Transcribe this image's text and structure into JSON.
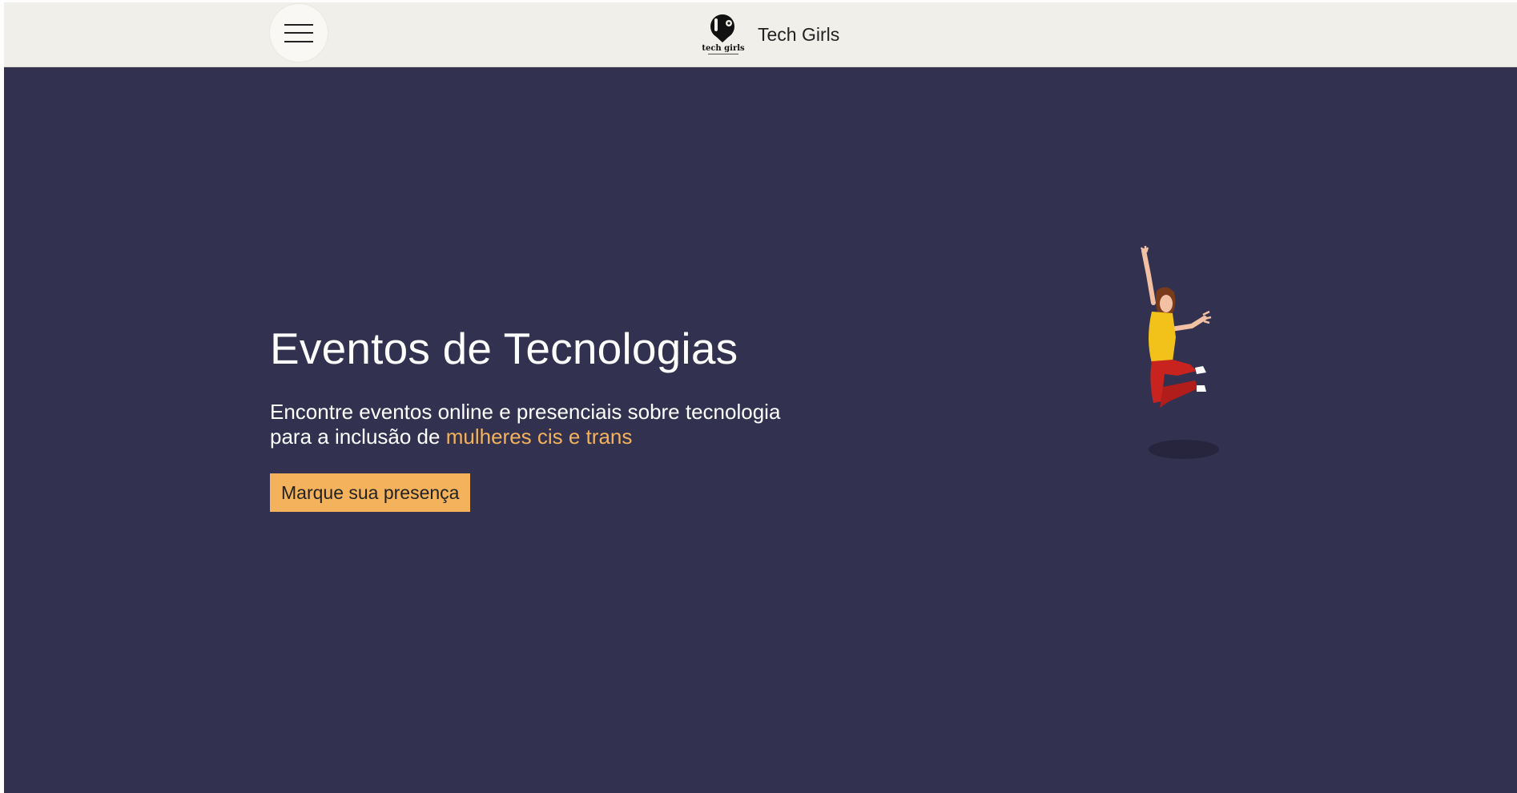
{
  "navbar": {
    "menu_icon": "hamburger-menu-icon",
    "brand_name": "Tech Girls",
    "logo_text": "tech girls"
  },
  "hero": {
    "title": "Eventos de Tecnologias",
    "text_line1": "Encontre eventos online e presenciais sobre tecnologia",
    "text_line2_prefix": "para a inclusão de ",
    "text_highlight": "mulheres cis e trans",
    "cta_label": "Marque sua presença",
    "illustration": "jumping-woman-illustration"
  },
  "colors": {
    "navbar_bg": "#f1efe9",
    "hero_bg": "#32314f",
    "accent": "#f4b25c",
    "text_light": "#ffffff"
  }
}
